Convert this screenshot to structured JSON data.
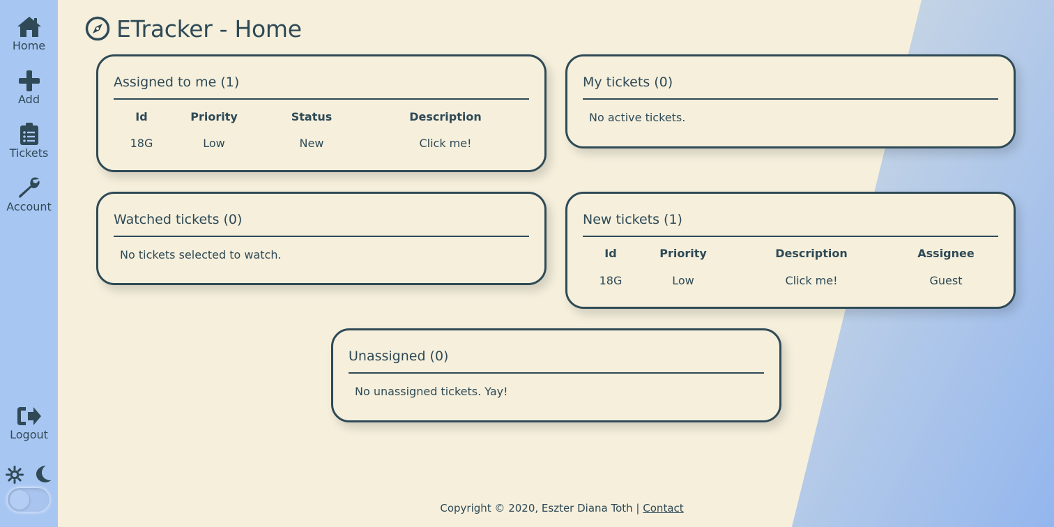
{
  "app": {
    "title": "ETracker - Home"
  },
  "colors": {
    "ink": "#2f4a56",
    "background": "#f5efdc",
    "sidebar": "#a8c6f2",
    "accent_blue": "#94b8ef"
  },
  "sidebar": {
    "items": [
      {
        "label": "Home",
        "icon": "home-icon"
      },
      {
        "label": "Add",
        "icon": "plus-icon"
      },
      {
        "label": "Tickets",
        "icon": "clipboard-icon"
      },
      {
        "label": "Account",
        "icon": "wrench-icon"
      }
    ],
    "logout": {
      "label": "Logout",
      "icon": "logout-icon"
    },
    "theme": {
      "light_icon": "sun-icon",
      "dark_icon": "moon-icon",
      "dark_mode": false
    }
  },
  "cards": {
    "assigned": {
      "title": "Assigned to me (1)",
      "columns": [
        "Id",
        "Priority",
        "Status",
        "Description"
      ],
      "rows": [
        [
          "18G",
          "Low",
          "New",
          "Click me!"
        ]
      ]
    },
    "my_tickets": {
      "title": "My tickets (0)",
      "empty": "No active tickets."
    },
    "watched": {
      "title": "Watched tickets (0)",
      "empty": "No tickets selected to watch."
    },
    "new_tickets": {
      "title": "New tickets (1)",
      "columns": [
        "Id",
        "Priority",
        "Description",
        "Assignee"
      ],
      "rows": [
        [
          "18G",
          "Low",
          "Click me!",
          "Guest"
        ]
      ]
    },
    "unassigned": {
      "title": "Unassigned (0)",
      "empty": "No unassigned tickets. Yay!"
    }
  },
  "footer": {
    "copyright": "Copyright © 2020, Eszter Diana Toth |",
    "contact": "Contact"
  }
}
